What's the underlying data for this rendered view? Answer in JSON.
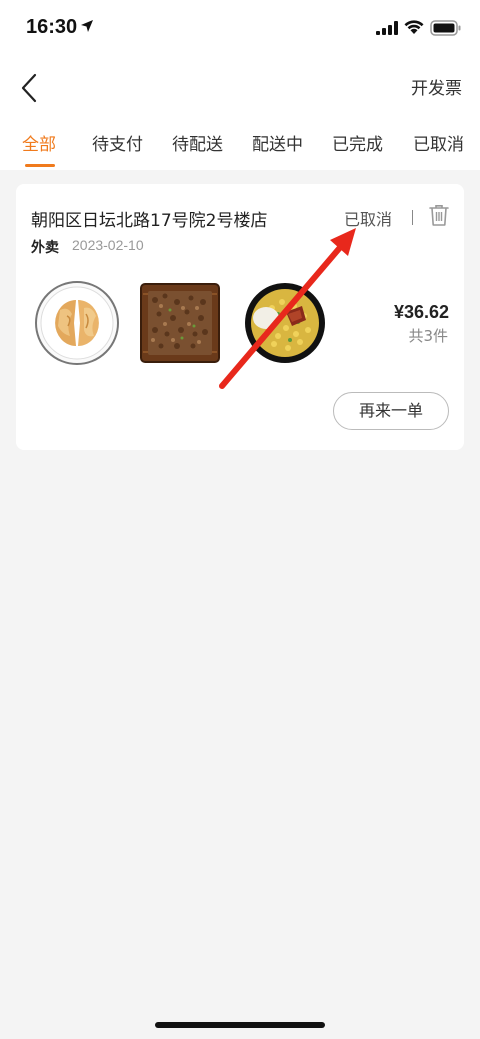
{
  "status_bar": {
    "time": "16:30",
    "icons": [
      "location-arrow-icon",
      "signal-icon",
      "wifi-icon",
      "battery-icon"
    ]
  },
  "nav": {
    "back_icon": "chevron-left-icon",
    "invoice_label": "开发票"
  },
  "tabs": [
    {
      "label": "全部",
      "active": true
    },
    {
      "label": "待支付",
      "active": false
    },
    {
      "label": "待配送",
      "active": false
    },
    {
      "label": "配送中",
      "active": false
    },
    {
      "label": "已完成",
      "active": false
    },
    {
      "label": "已取消",
      "active": false
    }
  ],
  "order": {
    "store_name": "朝阳区日坛北路17号院2号楼店",
    "status": "已取消",
    "type": "外卖",
    "date": "2023-02-10",
    "price": "¥36.62",
    "item_count": "共3件",
    "reorder_label": "再来一单",
    "items": [
      "pancake-plate",
      "minced-beef-tray",
      "corn-rice-bowl"
    ]
  },
  "colors": {
    "accent": "#f07a1c",
    "annotation": "#e8281c",
    "background": "#f4f4f4"
  }
}
